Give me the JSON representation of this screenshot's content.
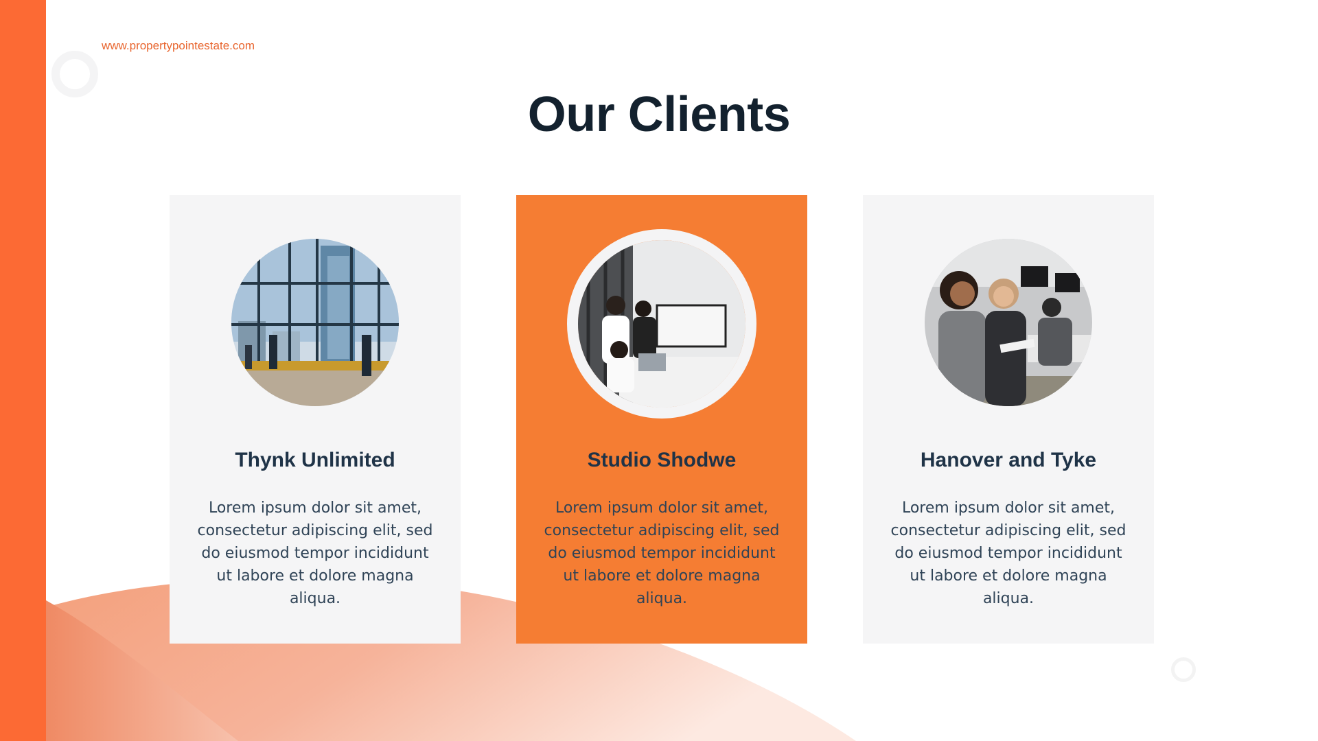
{
  "header": {
    "website": "www.propertypointestate.com",
    "title": "Our Clients"
  },
  "colors": {
    "accent": "#fc6a34",
    "card_highlight": "#f57d33",
    "card_default": "#f5f5f6",
    "title": "#13212e",
    "text": "#2f4356"
  },
  "clients": [
    {
      "name": "Thynk Unlimited",
      "description": "Lorem ipsum dolor sit amet, consectetur adipiscing elit, sed do eiusmod tempor incididunt ut labore et dolore magna aliqua.",
      "photo": "office-window-city-photo"
    },
    {
      "name": "Studio Shodwe",
      "description": "Lorem ipsum dolor sit amet, consectetur adipiscing elit, sed do eiusmod tempor incididunt ut labore et dolore magna aliqua.",
      "photo": "team-meeting-photo"
    },
    {
      "name": "Hanover and Tyke",
      "description": "Lorem ipsum dolor sit amet, consectetur adipiscing elit, sed do eiusmod tempor incididunt ut labore et dolore magna aliqua.",
      "photo": "coworkers-office-photo"
    }
  ]
}
